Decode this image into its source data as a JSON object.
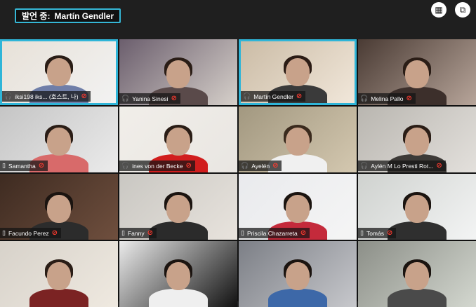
{
  "header": {
    "speaking_label": "발언 중:",
    "speaking_name": "Martín Gendler"
  },
  "toolbar": {
    "view_icon": "grid-view-icon",
    "popout_icon": "popout-icon"
  },
  "participants": [
    {
      "name": "iksi198 iks... (호스트, 나)",
      "icon": "headset-icon",
      "active": true
    },
    {
      "name": "Yanina Sinesi",
      "icon": "headset-icon",
      "active": false
    },
    {
      "name": "Martín Gendler",
      "icon": "headset-icon",
      "active": true
    },
    {
      "name": "Melina Pallo",
      "icon": "headset-icon",
      "active": false
    },
    {
      "name": "Samantha",
      "icon": "phone-icon",
      "active": false
    },
    {
      "name": "ines von der Becke",
      "icon": "headset-icon",
      "active": false
    },
    {
      "name": "Ayelén",
      "icon": "headset-icon",
      "active": false
    },
    {
      "name": "Aylén M Lo Presti Rot...",
      "icon": "headset-icon",
      "active": false
    },
    {
      "name": "Facundo Perez",
      "icon": "phone-icon",
      "active": false
    },
    {
      "name": "Fanny",
      "icon": "phone-icon",
      "active": false
    },
    {
      "name": "Priscila Chazarreta",
      "icon": "phone-icon",
      "active": false
    },
    {
      "name": "Tomás",
      "icon": "phone-icon",
      "active": false
    },
    {
      "name": "",
      "icon": "",
      "active": false
    },
    {
      "name": "",
      "icon": "",
      "active": false
    },
    {
      "name": "",
      "icon": "",
      "active": false
    },
    {
      "name": "",
      "icon": "",
      "active": false
    }
  ],
  "colors": {
    "accent": "#35b7d6",
    "mute": "#ff3b30"
  }
}
